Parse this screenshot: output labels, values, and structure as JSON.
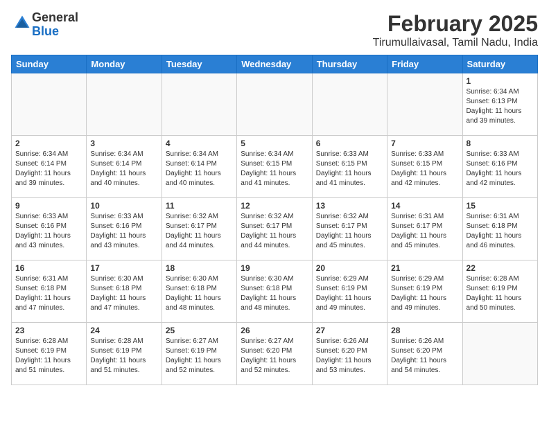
{
  "logo": {
    "general": "General",
    "blue": "Blue"
  },
  "title": "February 2025",
  "location": "Tirumullaivasal, Tamil Nadu, India",
  "weekdays": [
    "Sunday",
    "Monday",
    "Tuesday",
    "Wednesday",
    "Thursday",
    "Friday",
    "Saturday"
  ],
  "weeks": [
    [
      {
        "day": null
      },
      {
        "day": null
      },
      {
        "day": null
      },
      {
        "day": null
      },
      {
        "day": null
      },
      {
        "day": null
      },
      {
        "day": 1,
        "sunrise": "6:34 AM",
        "sunset": "6:13 PM",
        "daylight": "11 hours and 39 minutes."
      }
    ],
    [
      {
        "day": 2,
        "sunrise": "6:34 AM",
        "sunset": "6:14 PM",
        "daylight": "11 hours and 39 minutes."
      },
      {
        "day": 3,
        "sunrise": "6:34 AM",
        "sunset": "6:14 PM",
        "daylight": "11 hours and 40 minutes."
      },
      {
        "day": 4,
        "sunrise": "6:34 AM",
        "sunset": "6:14 PM",
        "daylight": "11 hours and 40 minutes."
      },
      {
        "day": 5,
        "sunrise": "6:34 AM",
        "sunset": "6:15 PM",
        "daylight": "11 hours and 41 minutes."
      },
      {
        "day": 6,
        "sunrise": "6:33 AM",
        "sunset": "6:15 PM",
        "daylight": "11 hours and 41 minutes."
      },
      {
        "day": 7,
        "sunrise": "6:33 AM",
        "sunset": "6:15 PM",
        "daylight": "11 hours and 42 minutes."
      },
      {
        "day": 8,
        "sunrise": "6:33 AM",
        "sunset": "6:16 PM",
        "daylight": "11 hours and 42 minutes."
      }
    ],
    [
      {
        "day": 9,
        "sunrise": "6:33 AM",
        "sunset": "6:16 PM",
        "daylight": "11 hours and 43 minutes."
      },
      {
        "day": 10,
        "sunrise": "6:33 AM",
        "sunset": "6:16 PM",
        "daylight": "11 hours and 43 minutes."
      },
      {
        "day": 11,
        "sunrise": "6:32 AM",
        "sunset": "6:17 PM",
        "daylight": "11 hours and 44 minutes."
      },
      {
        "day": 12,
        "sunrise": "6:32 AM",
        "sunset": "6:17 PM",
        "daylight": "11 hours and 44 minutes."
      },
      {
        "day": 13,
        "sunrise": "6:32 AM",
        "sunset": "6:17 PM",
        "daylight": "11 hours and 45 minutes."
      },
      {
        "day": 14,
        "sunrise": "6:31 AM",
        "sunset": "6:17 PM",
        "daylight": "11 hours and 45 minutes."
      },
      {
        "day": 15,
        "sunrise": "6:31 AM",
        "sunset": "6:18 PM",
        "daylight": "11 hours and 46 minutes."
      }
    ],
    [
      {
        "day": 16,
        "sunrise": "6:31 AM",
        "sunset": "6:18 PM",
        "daylight": "11 hours and 47 minutes."
      },
      {
        "day": 17,
        "sunrise": "6:30 AM",
        "sunset": "6:18 PM",
        "daylight": "11 hours and 47 minutes."
      },
      {
        "day": 18,
        "sunrise": "6:30 AM",
        "sunset": "6:18 PM",
        "daylight": "11 hours and 48 minutes."
      },
      {
        "day": 19,
        "sunrise": "6:30 AM",
        "sunset": "6:18 PM",
        "daylight": "11 hours and 48 minutes."
      },
      {
        "day": 20,
        "sunrise": "6:29 AM",
        "sunset": "6:19 PM",
        "daylight": "11 hours and 49 minutes."
      },
      {
        "day": 21,
        "sunrise": "6:29 AM",
        "sunset": "6:19 PM",
        "daylight": "11 hours and 49 minutes."
      },
      {
        "day": 22,
        "sunrise": "6:28 AM",
        "sunset": "6:19 PM",
        "daylight": "11 hours and 50 minutes."
      }
    ],
    [
      {
        "day": 23,
        "sunrise": "6:28 AM",
        "sunset": "6:19 PM",
        "daylight": "11 hours and 51 minutes."
      },
      {
        "day": 24,
        "sunrise": "6:28 AM",
        "sunset": "6:19 PM",
        "daylight": "11 hours and 51 minutes."
      },
      {
        "day": 25,
        "sunrise": "6:27 AM",
        "sunset": "6:19 PM",
        "daylight": "11 hours and 52 minutes."
      },
      {
        "day": 26,
        "sunrise": "6:27 AM",
        "sunset": "6:20 PM",
        "daylight": "11 hours and 52 minutes."
      },
      {
        "day": 27,
        "sunrise": "6:26 AM",
        "sunset": "6:20 PM",
        "daylight": "11 hours and 53 minutes."
      },
      {
        "day": 28,
        "sunrise": "6:26 AM",
        "sunset": "6:20 PM",
        "daylight": "11 hours and 54 minutes."
      },
      {
        "day": null
      }
    ]
  ]
}
